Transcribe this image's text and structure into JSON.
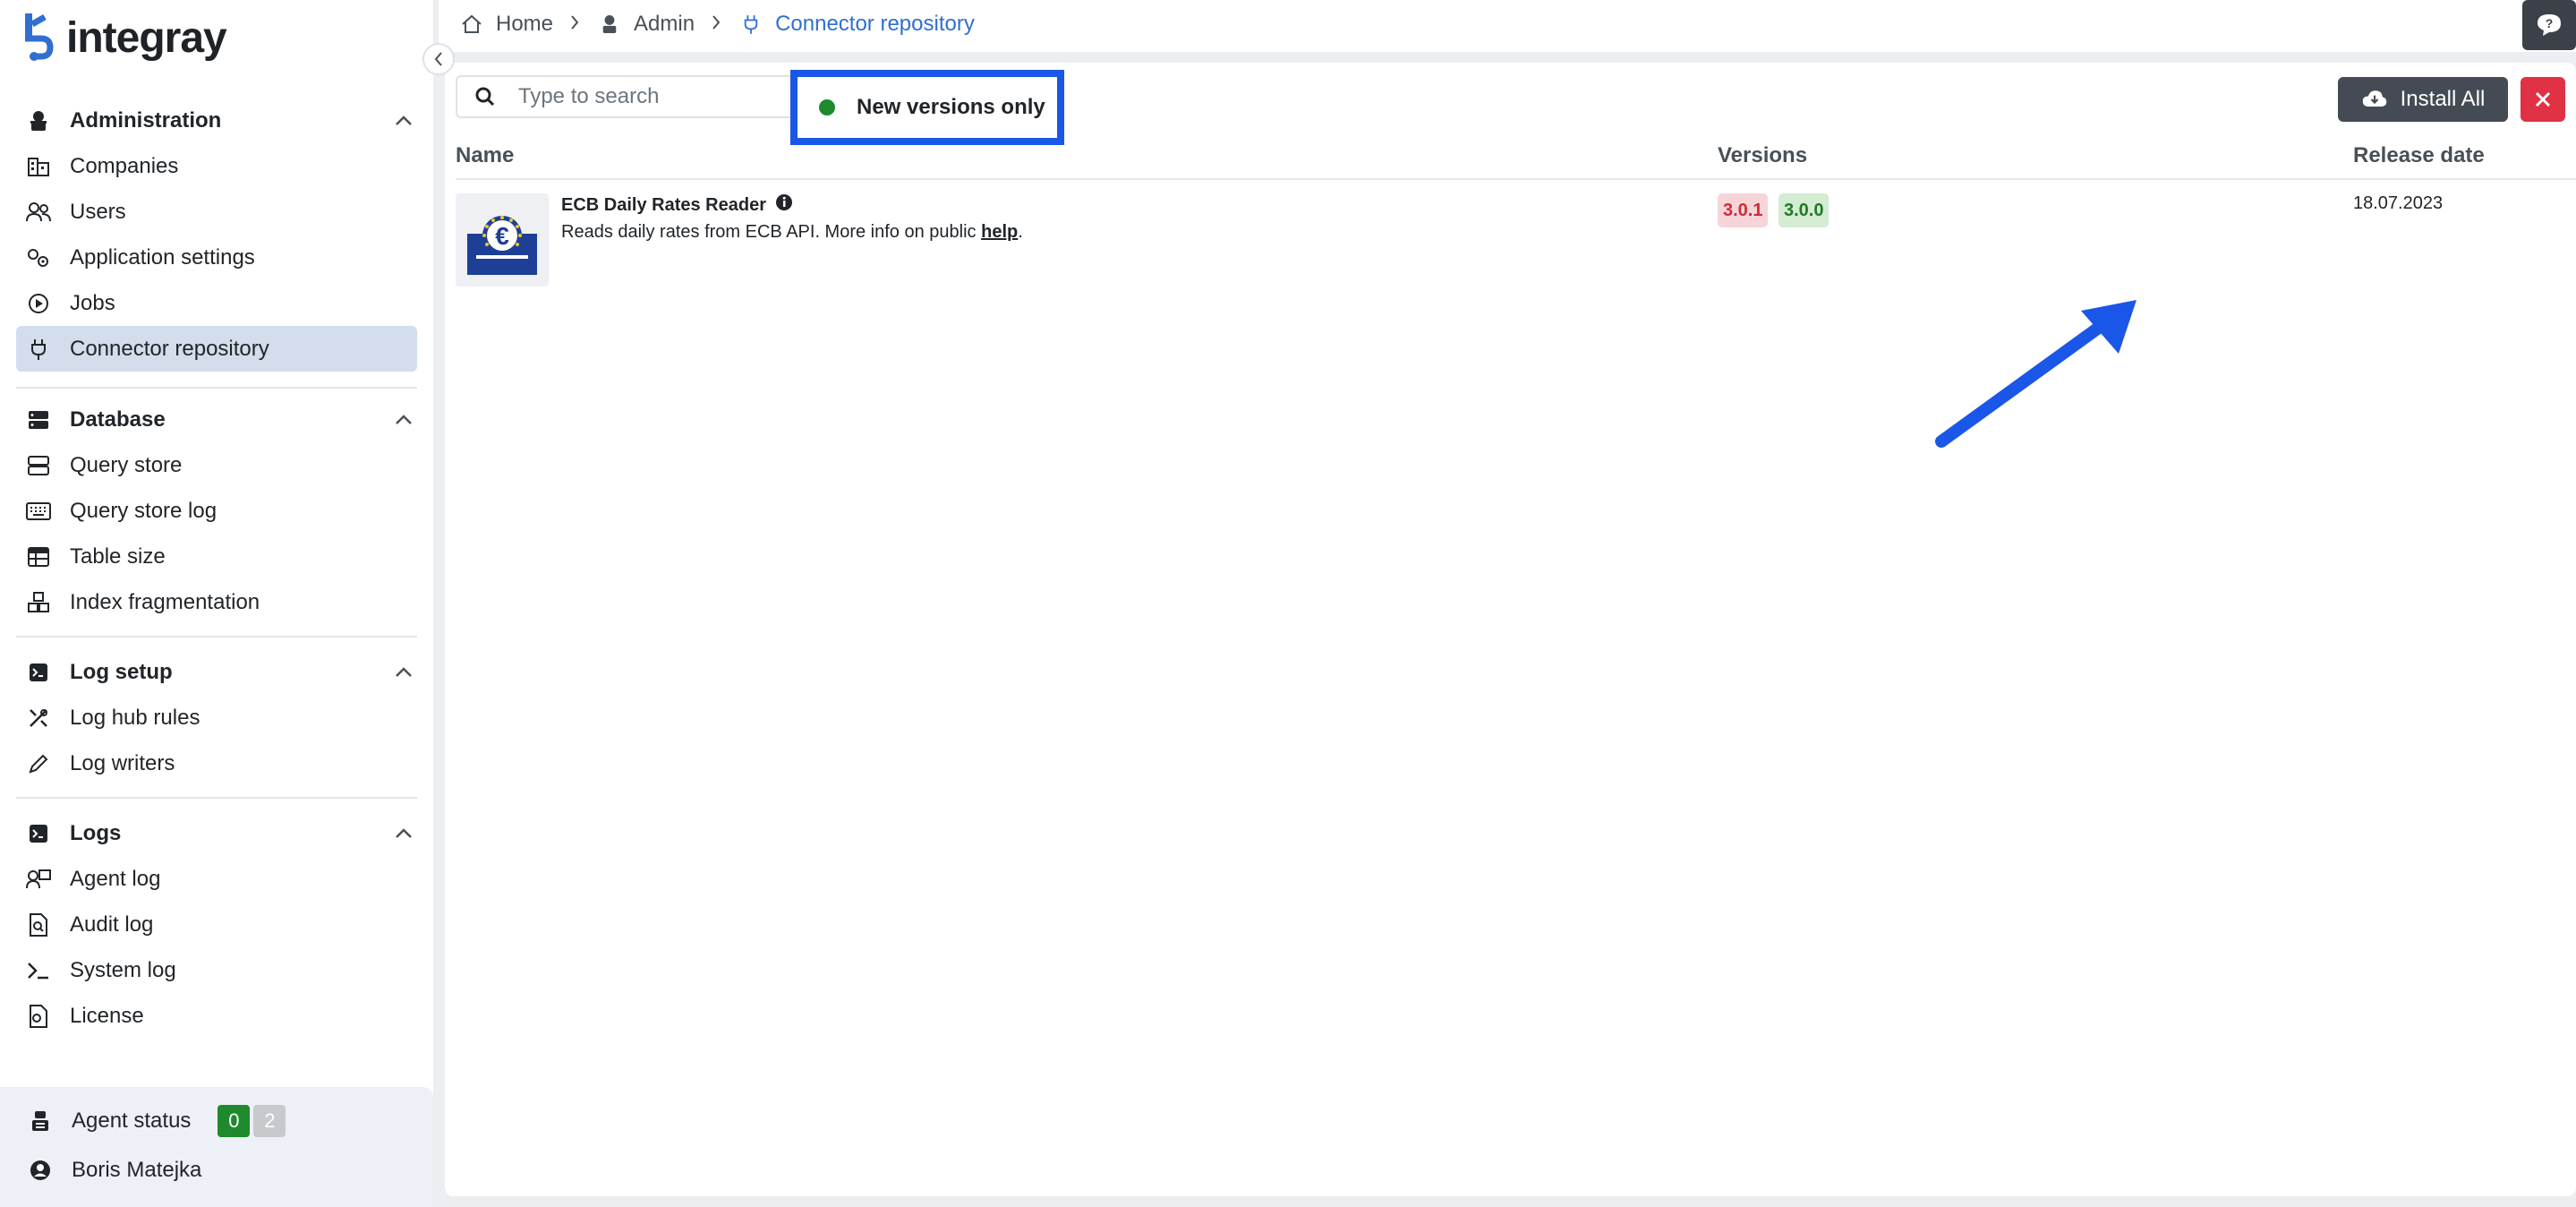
{
  "app": {
    "logo_text": "integray"
  },
  "colors": {
    "accent": "#2f6fd1",
    "highlight": "#1a56e8",
    "danger": "#e03145",
    "success": "#1e8a2d",
    "sidebar_active": "#d3ddec"
  },
  "sidebar": {
    "sections": [
      {
        "title": "Administration",
        "icon": "admin-icon",
        "items": [
          {
            "label": "Companies",
            "icon": "companies-icon"
          },
          {
            "label": "Users",
            "icon": "users-icon"
          },
          {
            "label": "Application settings",
            "icon": "settings-icon"
          },
          {
            "label": "Jobs",
            "icon": "play-circle-icon"
          },
          {
            "label": "Connector repository",
            "icon": "plug-icon",
            "active": true
          }
        ]
      },
      {
        "title": "Database",
        "icon": "database-icon",
        "items": [
          {
            "label": "Query store",
            "icon": "server-icon"
          },
          {
            "label": "Query store log",
            "icon": "keyboard-icon"
          },
          {
            "label": "Table size",
            "icon": "table-icon"
          },
          {
            "label": "Index fragmentation",
            "icon": "boxes-icon"
          }
        ]
      },
      {
        "title": "Log setup",
        "icon": "terminal-icon",
        "items": [
          {
            "label": "Log hub rules",
            "icon": "tools-icon"
          },
          {
            "label": "Log writers",
            "icon": "pencil-icon"
          }
        ]
      },
      {
        "title": "Logs",
        "icon": "terminal-icon",
        "items": [
          {
            "label": "Agent log",
            "icon": "agent-log-icon"
          },
          {
            "label": "Audit log",
            "icon": "file-search-icon"
          },
          {
            "label": "System log",
            "icon": "prompt-icon"
          },
          {
            "label": "License",
            "icon": "license-icon"
          }
        ]
      }
    ],
    "footer": {
      "agent_status_label": "Agent status",
      "agent_online": "0",
      "agent_offline": "2",
      "user_name": "Boris Matejka"
    }
  },
  "breadcrumb": [
    {
      "label": "Home",
      "icon": "home-icon"
    },
    {
      "label": "Admin",
      "icon": "admin-icon"
    },
    {
      "label": "Connector repository",
      "icon": "plug-icon"
    }
  ],
  "toolbar": {
    "search_placeholder": "Type to search",
    "toggle_label": "New versions only",
    "install_all_label": "Install All"
  },
  "table": {
    "headers": {
      "name": "Name",
      "versions": "Versions",
      "release": "Release date"
    },
    "rows": [
      {
        "name": "ECB Daily Rates Reader",
        "description_prefix": "Reads daily rates from ECB API. More info on public ",
        "description_link": "help",
        "description_suffix": ".",
        "version_installed": "3.0.1",
        "version_available": "3.0.0",
        "release_date": "18.07.2023"
      }
    ]
  }
}
